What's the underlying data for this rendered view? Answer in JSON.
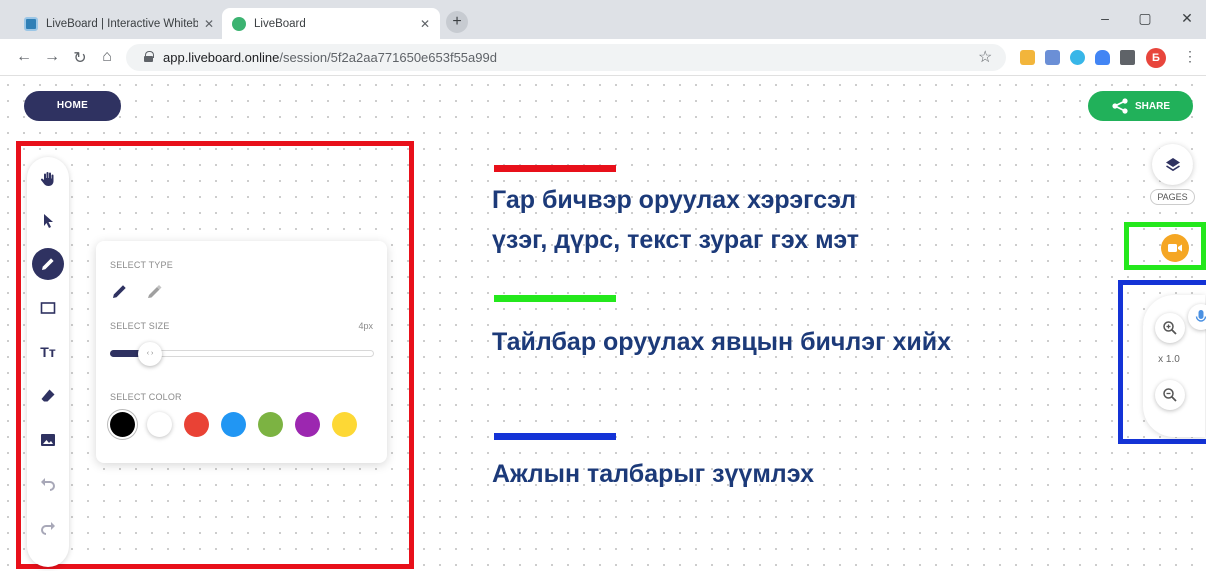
{
  "browser": {
    "tabs": [
      {
        "title": "LiveBoard | Interactive Whiteboa",
        "active": false
      },
      {
        "title": "LiveBoard",
        "active": true
      }
    ],
    "new_tab": "+",
    "minimize": "–",
    "maximize": "▢",
    "close": "✕",
    "url_host": "app.liveboard.online",
    "url_path": "/session/5f2a2aa771650e653f55a99d",
    "profile_initial": "Б"
  },
  "header": {
    "home_label": "HOME",
    "share_label": "SHARE"
  },
  "toolbar": {
    "tools": [
      "hand-icon",
      "select-icon",
      "pen-icon",
      "rectangle-icon",
      "text-icon",
      "eraser-icon",
      "image-icon",
      "undo-icon",
      "redo-icon"
    ],
    "active_tool": "pen-icon",
    "text_tool_label": "Tт"
  },
  "settings_panel": {
    "select_type_label": "SELECT TYPE",
    "select_size_label": "SELECT SIZE",
    "size_value": "4px",
    "size_fraction": 0.1,
    "slider_thumb_label": "‹ ›",
    "select_color_label": "SELECT COLOR",
    "colors": [
      "#000000",
      "#ffffff",
      "#e94235",
      "#2196f3",
      "#7cb342",
      "#9c27b0",
      "#fdd835"
    ],
    "selected_color": "#000000"
  },
  "annotations": [
    {
      "color": "#e8101a",
      "lines": [
        "Гар бичвэр оруулах хэрэгсэл",
        "үзэг, дүрс, текст зураг гэх  мэт"
      ]
    },
    {
      "color": "#24e81c",
      "lines": [
        "Тайлбар оруулах явцын бичлэг хийх"
      ]
    },
    {
      "color": "#1433d6",
      "lines": [
        "Ажлын талбарыг зүүмлэх"
      ]
    }
  ],
  "right_panel": {
    "pages_label": "PAGES",
    "zoom_level": "x 1.0"
  },
  "colors": {
    "brand_dark": "#2f3261",
    "share_green": "#21b15a",
    "camera_orange": "#f5a623"
  }
}
